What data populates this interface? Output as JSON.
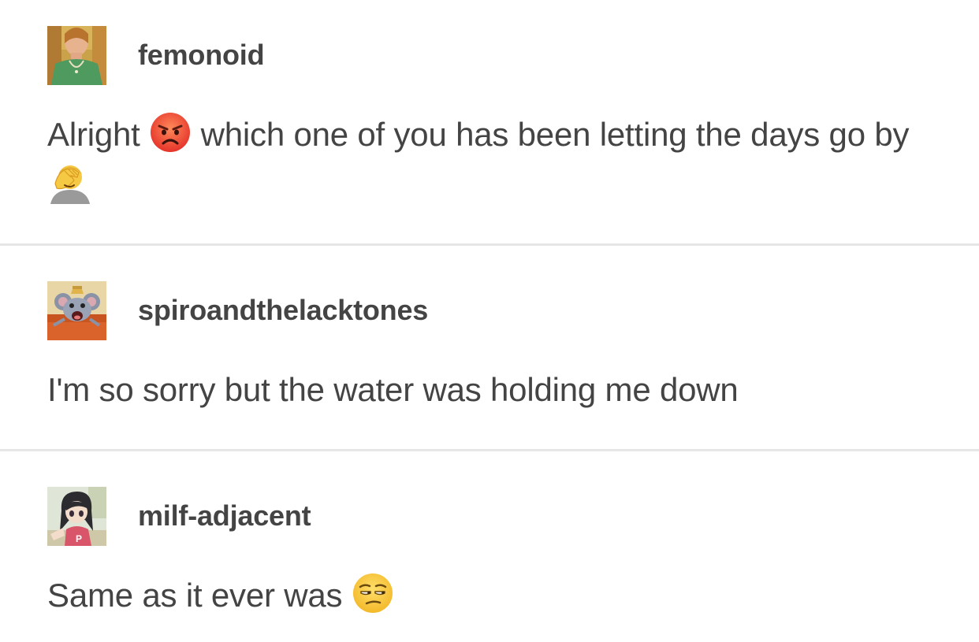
{
  "posts": [
    {
      "username": "femonoid",
      "avatar_icon": "avatar-painted-portrait",
      "text_before": "Alright ",
      "emoji_1": "angry-face-emoji",
      "text_middle": " which one of you has been letting the days go by",
      "emoji_2": "face-palm-emoji"
    },
    {
      "username": "spiroandthelacktones",
      "avatar_icon": "avatar-cartoon-rat",
      "text": "I'm so sorry but the water was holding me down"
    },
    {
      "username": "milf-adjacent",
      "avatar_icon": "avatar-anime-girl",
      "text": "Same as it ever was ",
      "emoji_1": "unamused-face-emoji"
    }
  ]
}
